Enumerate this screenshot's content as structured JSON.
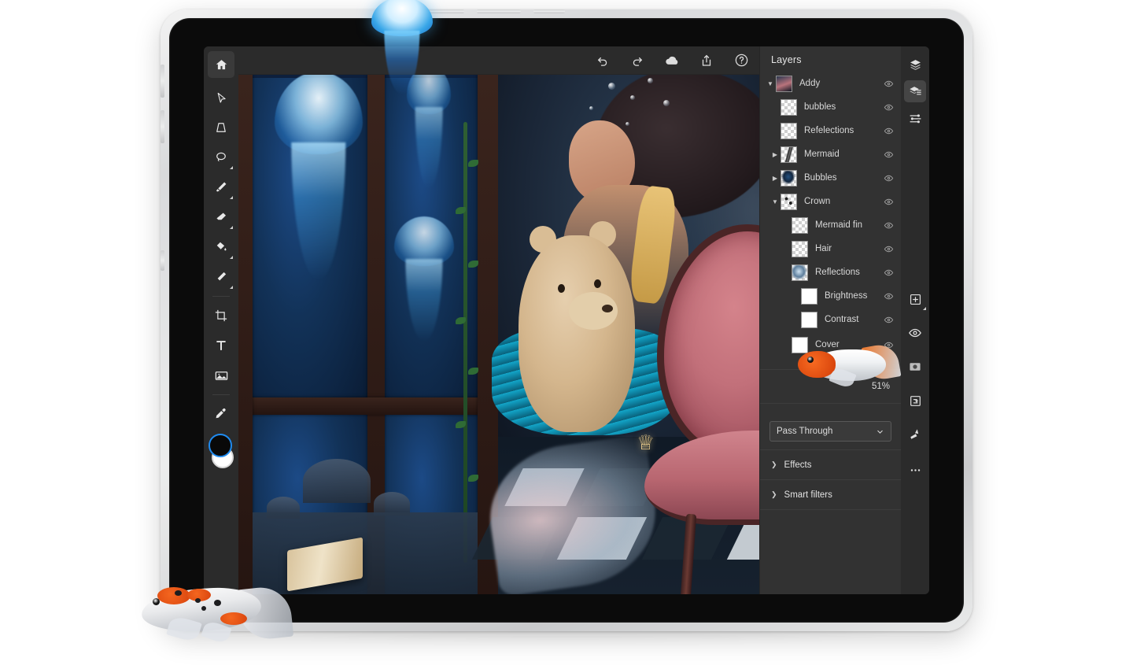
{
  "app": {
    "name": "photo-editor",
    "toolbar": {
      "tools": [
        {
          "id": "home",
          "label": "Home",
          "icon": "home-icon",
          "submenu": false
        },
        {
          "id": "select",
          "label": "Move and select",
          "icon": "cursor-arrow-icon",
          "submenu": false
        },
        {
          "id": "transform",
          "label": "Transform",
          "icon": "transform-icon",
          "submenu": false
        },
        {
          "id": "lasso",
          "label": "Lasso select",
          "icon": "lasso-icon",
          "submenu": true
        },
        {
          "id": "brush",
          "label": "Brush",
          "icon": "paintbrush-icon",
          "submenu": true
        },
        {
          "id": "eraser",
          "label": "Eraser",
          "icon": "eraser-icon",
          "submenu": true
        },
        {
          "id": "fill",
          "label": "Paint bucket",
          "icon": "paint-bucket-icon",
          "submenu": true
        },
        {
          "id": "smudge",
          "label": "Smudge",
          "icon": "smudge-icon",
          "submenu": true
        },
        {
          "id": "crop",
          "label": "Crop",
          "icon": "crop-icon",
          "submenu": false
        },
        {
          "id": "type",
          "label": "Type",
          "icon": "text-type-icon",
          "submenu": false
        },
        {
          "id": "place",
          "label": "Place image",
          "icon": "image-icon",
          "submenu": false
        },
        {
          "id": "eyedropper",
          "label": "Eyedropper",
          "icon": "eyedropper-icon",
          "submenu": false
        }
      ],
      "foreground_color": "#090909",
      "background_color": "#ffffff",
      "active_swatch_outline": "#1f8bf0"
    },
    "topbar": {
      "buttons": [
        {
          "id": "undo",
          "label": "Undo",
          "icon": "undo-arrow-icon"
        },
        {
          "id": "redo",
          "label": "Redo",
          "icon": "redo-arrow-icon"
        },
        {
          "id": "cloud",
          "label": "Cloud documents",
          "icon": "cloud-icon"
        },
        {
          "id": "share",
          "label": "Share and export",
          "icon": "share-upload-icon"
        },
        {
          "id": "help",
          "label": "Help",
          "icon": "help-question-icon"
        }
      ]
    },
    "panel": {
      "title": "Layers",
      "layers": [
        {
          "name": "Addy",
          "indent": 0,
          "twisty": "down",
          "thumb": "composite",
          "visible": true
        },
        {
          "name": "bubbles",
          "indent": 1,
          "twisty": "none",
          "thumb": "empty",
          "visible": true
        },
        {
          "name": "Refelections",
          "indent": 1,
          "twisty": "none",
          "thumb": "empty",
          "visible": true
        },
        {
          "name": "Mermaid",
          "indent": 1,
          "twisty": "right",
          "thumb": "streak",
          "visible": true
        },
        {
          "name": "Bubbles",
          "indent": 1,
          "twisty": "right",
          "thumb": "figure",
          "visible": true
        },
        {
          "name": "Crown",
          "indent": 1,
          "twisty": "down",
          "thumb": "specks",
          "visible": true
        },
        {
          "name": "Mermaid fin",
          "indent": 2,
          "twisty": "none",
          "thumb": "empty",
          "visible": true
        },
        {
          "name": "Hair",
          "indent": 2,
          "twisty": "none",
          "thumb": "empty",
          "visible": true
        },
        {
          "name": "Reflections",
          "indent": 2,
          "twisty": "none",
          "thumb": "splash",
          "visible": true
        },
        {
          "name": "Brightness",
          "indent": 3,
          "twisty": "none",
          "thumb": "white",
          "visible": true
        },
        {
          "name": "Contrast",
          "indent": 3,
          "twisty": "none",
          "thumb": "white",
          "visible": true
        },
        {
          "name": "Cover",
          "indent": 2,
          "twisty": "none",
          "thumb": "white",
          "visible": true
        }
      ],
      "opacity_value": "51%",
      "blend_mode": "Pass Through",
      "sections": [
        {
          "label": "Effects",
          "expanded": false,
          "chevron": "chevron-right-icon"
        },
        {
          "label": "Smart filters",
          "expanded": false,
          "chevron": "chevron-right-icon"
        }
      ]
    },
    "rail": {
      "top_buttons": [
        {
          "id": "layer-stack",
          "label": "Layer stack",
          "icon": "layers-stack-icon",
          "active": false
        },
        {
          "id": "layer-properties",
          "label": "Layer properties",
          "icon": "layers-list-icon",
          "active": true
        },
        {
          "id": "adjustments",
          "label": "Adjustments",
          "icon": "sliders-icon",
          "active": false
        }
      ],
      "bottom_buttons": [
        {
          "id": "add-layer",
          "label": "Add layer",
          "icon": "plus-square-icon",
          "submenu": true
        },
        {
          "id": "visibility",
          "label": "Layer visibility",
          "icon": "eye-icon",
          "submenu": false
        },
        {
          "id": "mask",
          "label": "Layer mask",
          "icon": "mask-circle-icon",
          "submenu": false
        },
        {
          "id": "clipping",
          "label": "Clipping mask",
          "icon": "clipping-mask-icon",
          "submenu": false
        },
        {
          "id": "quick-actions",
          "label": "Quick actions",
          "icon": "magic-wand-icon",
          "submenu": false
        },
        {
          "id": "more",
          "label": "More options",
          "icon": "ellipsis-icon",
          "submenu": false
        }
      ]
    }
  },
  "artwork": {
    "title": "Underwater mermaid composite",
    "elements": [
      "jellyfish",
      "window",
      "girl",
      "teddy-bear",
      "mermaid-tail",
      "ornate-chair",
      "checkered-floor",
      "crown",
      "koi-fish",
      "goldfish",
      "book"
    ]
  },
  "device": {
    "type": "tablet",
    "frame_color": "#dcdddf",
    "screen_background": "#1e1e1e"
  }
}
